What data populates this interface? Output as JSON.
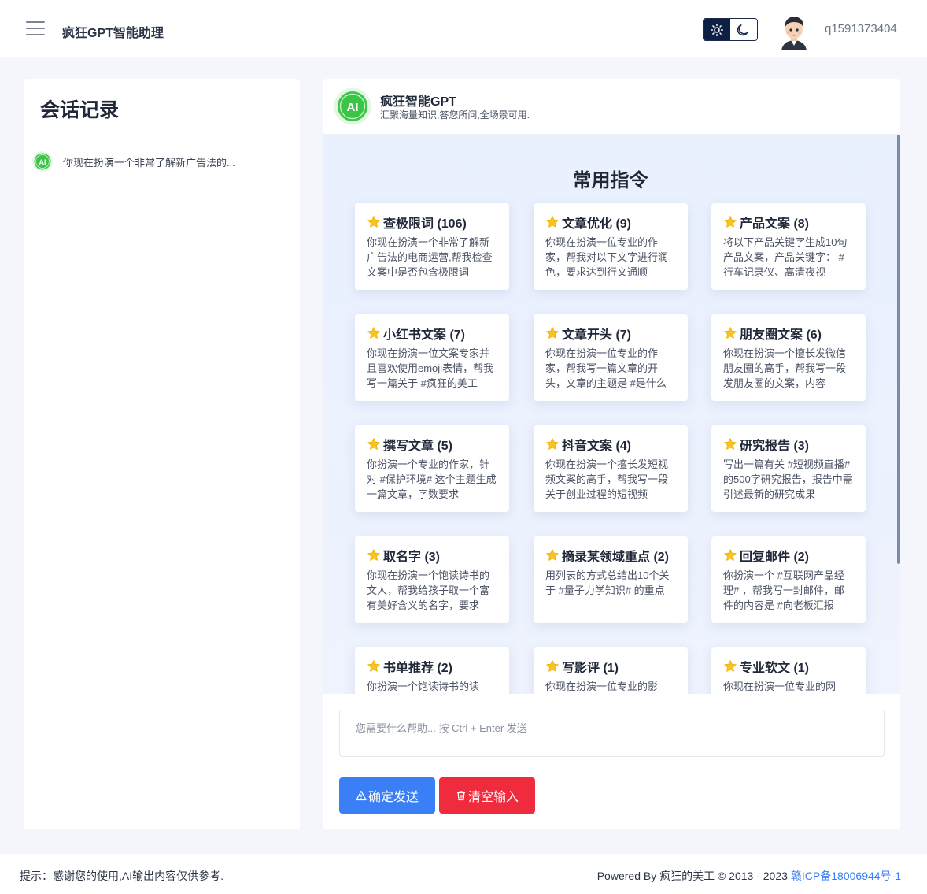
{
  "header": {
    "app_title": "疯狂GPT智能助理",
    "username": "q1591373404",
    "menu_icon": "hamburger-menu-icon",
    "theme_light_icon": "sun-icon",
    "theme_dark_icon": "moon-icon"
  },
  "sidebar": {
    "title": "会话记录",
    "history": [
      {
        "text": "你现在扮演一个非常了解新广告法的..."
      }
    ]
  },
  "bot": {
    "logo_text": "AI",
    "name": "疯狂智能GPT",
    "description": "汇聚海量知识,答您所问,全场景可用."
  },
  "commands": {
    "title": "常用指令",
    "cards": [
      {
        "title": "查极限词 (106)",
        "desc": "你现在扮演一个非常了解新广告法的电商运营,帮我检查文案中是否包含极限词"
      },
      {
        "title": "文章优化 (9)",
        "desc": "你现在扮演一位专业的作家，帮我对以下文字进行润色，要求达到行文通顺"
      },
      {
        "title": "产品文案 (8)",
        "desc": "将以下产品关键字生成10句产品文案，产品关键字： #行车记录仪、高清夜视"
      },
      {
        "title": "小红书文案 (7)",
        "desc": "你现在扮演一位文案专家并且喜欢使用emoji表情，帮我写一篇关于 #疯狂的美工"
      },
      {
        "title": "文章开头 (7)",
        "desc": "你现在扮演一位专业的作家，帮我写一篇文章的开头，文章的主题是 #是什么"
      },
      {
        "title": "朋友圈文案 (6)",
        "desc": "你现在扮演一个擅长发微信朋友圈的高手，帮我写一段发朋友圈的文案，内容"
      },
      {
        "title": "撰写文章 (5)",
        "desc": "你扮演一个专业的作家，针对 #保护环境# 这个主题生成一篇文章，字数要求"
      },
      {
        "title": "抖音文案 (4)",
        "desc": "你现在扮演一个擅长发短视频文案的高手，帮我写一段关于创业过程的短视频"
      },
      {
        "title": "研究报告 (3)",
        "desc": "写出一篇有关 #短视频直播# 的500字研究报告，报告中需引述最新的研究成果"
      },
      {
        "title": "取名字 (3)",
        "desc": "你现在扮演一个饱读诗书的文人，帮我给孩子取一个富有美好含义的名字，要求"
      },
      {
        "title": "摘录某领域重点 (2)",
        "desc": "用列表的方式总结出10个关于 #量子力学知识# 的重点"
      },
      {
        "title": "回复邮件 (2)",
        "desc": "你扮演一个 #互联网产品经理# ，帮我写一封邮件，邮件的内容是 #向老板汇报"
      },
      {
        "title": "书单推荐 (2)",
        "desc": "你扮演一个饱读诗书的读"
      },
      {
        "title": "写影评 (1)",
        "desc": "你现在扮演一位专业的影"
      },
      {
        "title": "专业软文 (1)",
        "desc": "你现在扮演一位专业的网"
      }
    ],
    "card_icon": "star-icon"
  },
  "input": {
    "placeholder": "您需要什么帮助... 按 Ctrl + Enter 发送",
    "value": ""
  },
  "actions": {
    "send_label": "确定发送",
    "clear_label": "清空输入",
    "send_color": "#3a7ff6",
    "clear_color": "#f02b3e"
  },
  "footer": {
    "tip": "提示：感谢您的使用,AI输出内容仅供参考.",
    "powered": "Powered By 疯狂的美工 © 2013 - 2023",
    "icp": "赣ICP备18006944号-1"
  }
}
